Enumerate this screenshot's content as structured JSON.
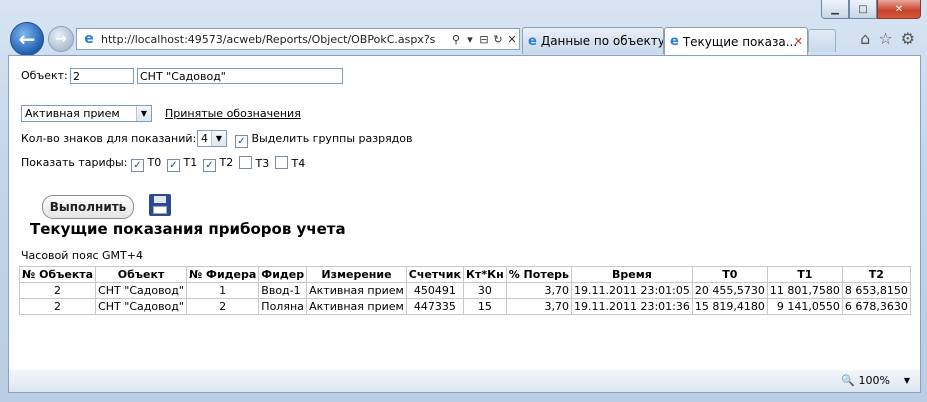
{
  "browser": {
    "url": "http://localhost:49573/acweb/Reports/Object/OBPokC.aspx?s",
    "tabs": [
      {
        "label": "Данные по объекту"
      },
      {
        "label": "Текущие показа..."
      }
    ],
    "zoom": "100%"
  },
  "form": {
    "object_label": "Объект:",
    "object_id": "2",
    "object_name": "СНТ \"Садовод\"",
    "mode_select": "Активная прием",
    "legend_link": "Принятые обозначения",
    "digits_label": "Кол-во знаков для показаний:",
    "digits_value": "4",
    "group_digits_label": "Выделить группы разрядов",
    "tariffs_label": "Показать тарифы:",
    "tariffs": [
      {
        "label": "T0",
        "checked": true
      },
      {
        "label": "T1",
        "checked": true
      },
      {
        "label": "T2",
        "checked": true
      },
      {
        "label": "T3",
        "checked": false
      },
      {
        "label": "T4",
        "checked": false
      }
    ],
    "run_button": "Выполнить"
  },
  "report": {
    "title": "Текущие показания приборов учета",
    "timezone": "Часовой пояс GMT+4",
    "columns": [
      "№ Объекта",
      "Объект",
      "№ Фидера",
      "Фидер",
      "Измерение",
      "Счетчик",
      "Кт*Кн",
      "% Потерь",
      "Время",
      "T0",
      "T1",
      "T2"
    ],
    "rows": [
      [
        "2",
        "СНТ \"Садовод\"",
        "1",
        "Ввод-1",
        "Активная прием",
        "450491",
        "30",
        "3,70",
        "19.11.2011 23:01:05",
        "20 455,5730",
        "11 801,7580",
        "8 653,8150"
      ],
      [
        "2",
        "СНТ \"Садовод\"",
        "2",
        "Поляна",
        "Активная прием",
        "447335",
        "15",
        "3,70",
        "19.11.2011 23:01:36",
        "15 819,4180",
        "9 141,0550",
        "6 678,3630"
      ]
    ]
  }
}
